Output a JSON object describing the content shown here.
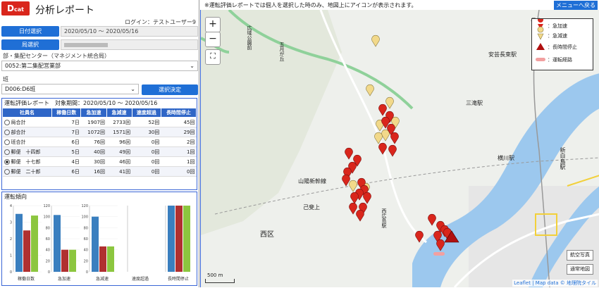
{
  "app": {
    "logo_main": "D",
    "logo_rest": "cat",
    "title": "分析レポート",
    "login": "ログイン：テストユーザー9"
  },
  "controls": {
    "date_button": "日付選択",
    "date_range": "2020/05/10 〜 2020/05/16",
    "office_button": "局選択",
    "dept_label": "部・集配センター（マネジメント統合局）",
    "dept_value": "0052:第二集配営業部",
    "team_label": "班",
    "team_value": "D006:D6班",
    "confirm_button": "選択決定"
  },
  "report": {
    "title": "運転評価レポート",
    "period": "対象期間：2020/05/10 〜 2020/05/16",
    "columns": [
      "社員名",
      "稼働日数",
      "急加速",
      "急減速",
      "速度超過",
      "長時間停止"
    ],
    "rows": [
      {
        "name": "局合計",
        "days": "7日",
        "accel": "1907回",
        "decel": "2733回",
        "speed": "52回",
        "stop": "45回",
        "selected": false
      },
      {
        "name": "部合計",
        "days": "7日",
        "accel": "1072回",
        "decel": "1571回",
        "speed": "30回",
        "stop": "29回",
        "selected": false
      },
      {
        "name": "班合計",
        "days": "6日",
        "accel": "76回",
        "decel": "96回",
        "speed": "0回",
        "stop": "2回",
        "selected": false
      },
      {
        "name": "郵便　十四郎",
        "days": "5日",
        "accel": "40回",
        "decel": "49回",
        "speed": "0回",
        "stop": "1回",
        "selected": false
      },
      {
        "name": "郵便　十七郎",
        "days": "4日",
        "accel": "30回",
        "decel": "46回",
        "speed": "0回",
        "stop": "1回",
        "selected": true
      },
      {
        "name": "郵便　二十郎",
        "days": "6日",
        "accel": "16回",
        "decel": "41回",
        "speed": "0回",
        "stop": "0回",
        "selected": false
      }
    ]
  },
  "trend": {
    "title": "運転傾向"
  },
  "chart_data": {
    "type": "bar",
    "categories": [
      "稼働日数",
      "急加速",
      "急減速",
      "速度超過",
      "長時間停止"
    ],
    "ylims": [
      [
        0,
        4
      ],
      [
        0,
        120
      ],
      [
        0,
        120
      ],
      [
        0,
        1
      ],
      [
        0,
        1
      ]
    ],
    "yticks": [
      [
        "0",
        "1",
        "2",
        "3",
        "4"
      ],
      [
        "0",
        "20",
        "40",
        "60",
        "80",
        "100",
        "120"
      ],
      [
        "0",
        "20",
        "40",
        "60",
        "80",
        "100",
        "120"
      ],
      [],
      []
    ],
    "series_colors": [
      "#3a7fbf",
      "#b03030",
      "#8cc63f"
    ],
    "values": [
      [
        3.5,
        2.5,
        3.4
      ],
      [
        103,
        40,
        40
      ],
      [
        100,
        46,
        46
      ],
      [
        0,
        0,
        0
      ],
      [
        1,
        1,
        1
      ]
    ]
  },
  "map": {
    "notice": "※運転評価レポートでは個人を選択した時のみ、地図上にアイコンが表示されます。",
    "back_button": "メニューへ戻る",
    "zoom_in": "+",
    "zoom_out": "−",
    "fullscreen": "⛶",
    "legend": {
      "accel": "：急加速",
      "decel": "：急減速",
      "stop": "：長時間停止",
      "route": "：運転経路"
    },
    "labels": [
      "広域公園前",
      "五月が丘",
      "安芸長束駅",
      "三滝駅",
      "横川駅",
      "新白島駅",
      "山陽新幹線",
      "己斐上",
      "西区",
      "西広島駅",
      "長束"
    ],
    "aerial_button": "航空写真",
    "normal_button": "通常地図",
    "scale": "500 m",
    "attribution": "Leaflet | Map data © 地理院タイル",
    "colors": {
      "accel": "#d9261c",
      "decel": "#f2d98a",
      "stop": "#b01010",
      "route": "#f2a0a0"
    }
  }
}
